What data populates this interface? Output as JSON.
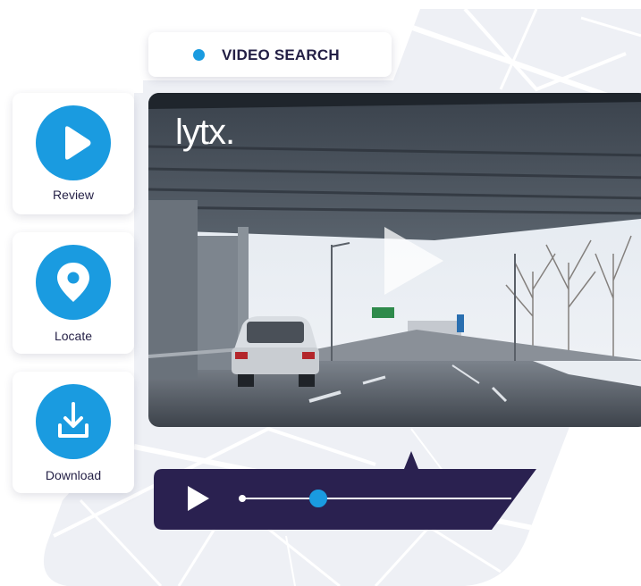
{
  "header": {
    "title": "VIDEO SEARCH",
    "indicator_color": "#1a9be0"
  },
  "actions": [
    {
      "label": "Review",
      "icon": "play-icon"
    },
    {
      "label": "Locate",
      "icon": "map-pin-icon"
    },
    {
      "label": "Download",
      "icon": "download-icon"
    }
  ],
  "video": {
    "logo_text": "lytx."
  },
  "player": {
    "play_icon": "play-icon",
    "progress": 0.28,
    "bar_color": "#2a2150",
    "accent_color": "#1a9be0"
  }
}
